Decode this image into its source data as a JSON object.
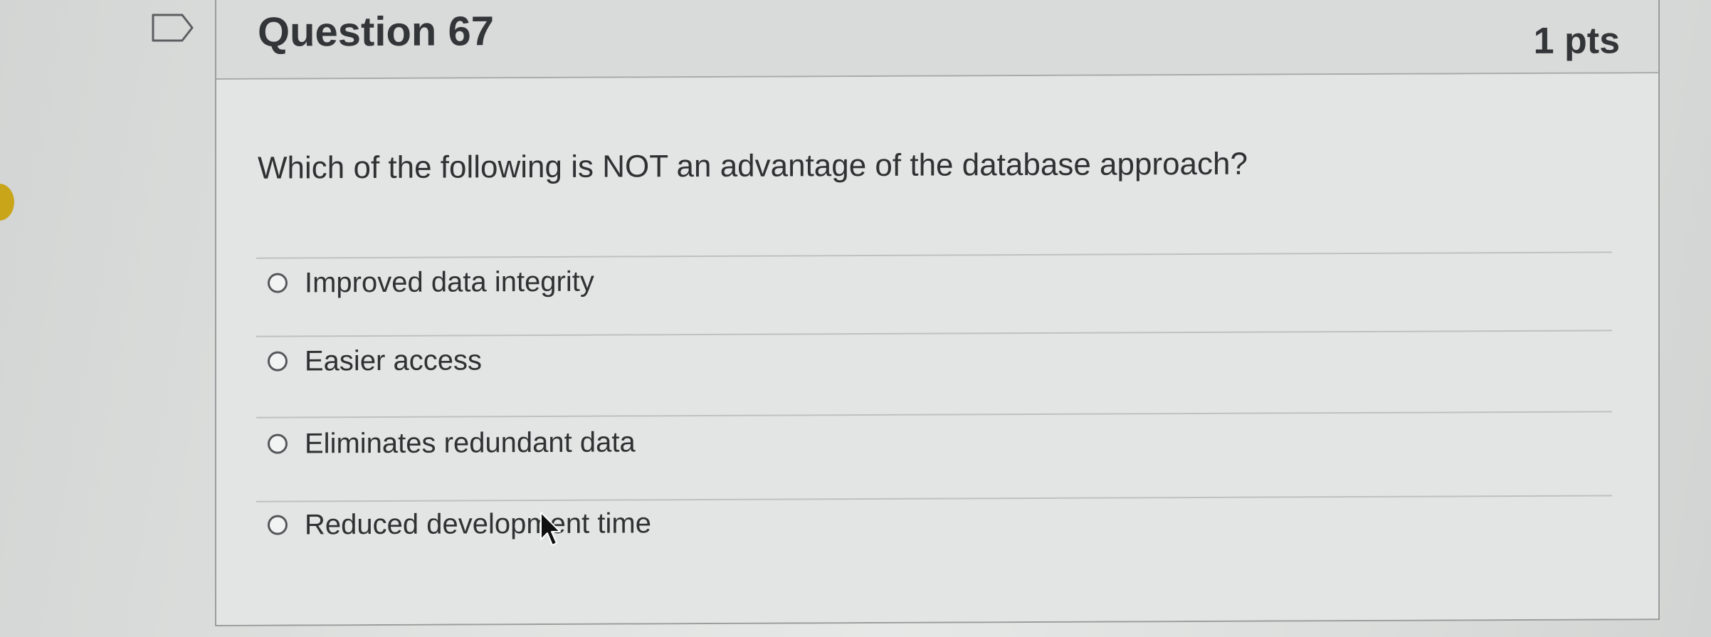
{
  "question": {
    "title": "Question 67",
    "points": "1 pts",
    "text": "Which of the following is NOT an advantage of the database approach?",
    "answers": [
      {
        "label": "Improved data integrity",
        "selected": false
      },
      {
        "label": "Easier access",
        "selected": false
      },
      {
        "label": "Eliminates redundant data",
        "selected": false
      },
      {
        "label": "Reduced development time",
        "selected": false
      }
    ]
  },
  "icons": {
    "flag": "bookmark-flag-icon",
    "radio": "radio-button-icon",
    "cursor": "mouse-pointer-icon"
  },
  "colors": {
    "accent_dot": "#c9a51a",
    "border": "#9a9c9d",
    "text": "#2f3133"
  }
}
